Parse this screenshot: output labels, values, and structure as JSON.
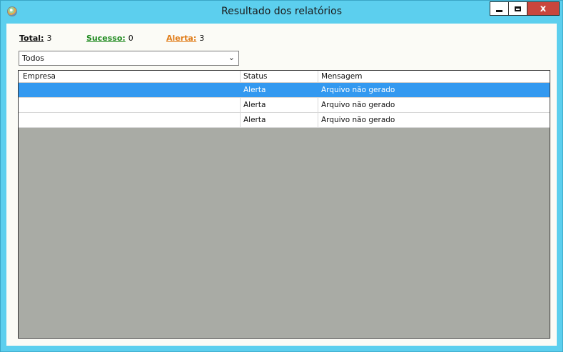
{
  "window": {
    "title": "Resultado dos relatórios",
    "icon": "app-globe-icon",
    "controls": {
      "minimize": "minimize-icon",
      "maximize": "maximize-icon",
      "close_label": "x"
    }
  },
  "summary": {
    "total_label": "Total:",
    "total_value": "3",
    "sucesso_label": "Sucesso:",
    "sucesso_value": "0",
    "alerta_label": "Alerta:",
    "alerta_value": "3"
  },
  "filter": {
    "selected": "Todos",
    "chevron": "⌄"
  },
  "grid": {
    "columns": [
      "Empresa",
      "Status",
      "Mensagem"
    ],
    "rows": [
      {
        "empresa": "",
        "status": "Alerta",
        "mensagem": "Arquivo não gerado",
        "selected": true
      },
      {
        "empresa": "",
        "status": "Alerta",
        "mensagem": "Arquivo não gerado",
        "selected": false
      },
      {
        "empresa": "",
        "status": "Alerta",
        "mensagem": "Arquivo não gerado",
        "selected": false
      }
    ]
  },
  "colors": {
    "titlebar": "#5ccfee",
    "client": "#fbfbf6",
    "grid_empty": "#a9aba5",
    "selection": "#3399f0",
    "sucesso": "#1f8a1f",
    "alerta": "#e07c18",
    "close_button": "#c9463d"
  }
}
